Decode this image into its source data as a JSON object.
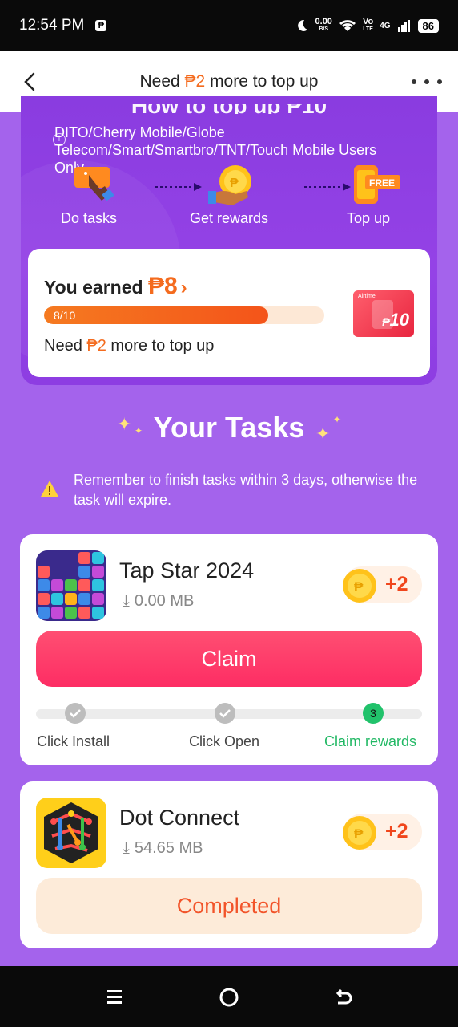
{
  "status_bar": {
    "time": "12:54 PM",
    "speed_value": "0.00",
    "speed_unit": "B/S",
    "volte_top": "Vo",
    "volte_bottom": "LTE",
    "network": "4G",
    "battery": "86"
  },
  "header": {
    "title_prefix": "Need ",
    "title_amount": "₱2",
    "title_suffix": " more to top up"
  },
  "panel": {
    "title": "How to top up ₱10",
    "notice": "DITO/Cherry Mobile/Globe Telecom/Smart/Smartbro/TNT/Touch Mobile Users Only",
    "steps": [
      "Do tasks",
      "Get rewards",
      "Top up"
    ],
    "free_badge": "FREE"
  },
  "earned": {
    "label": "You earned ",
    "amount": "₱8",
    "progress_text": "8/10",
    "progress_fraction": 0.8,
    "need_prefix": "Need ",
    "need_amount": "₱2",
    "need_suffix": " more to top up",
    "voucher_brand": "Airtime",
    "voucher_value": "10",
    "voucher_currency": "₱"
  },
  "tasks_section": {
    "title": "Your Tasks",
    "reminder": "Remember to finish tasks within 3 days, otherwise the task will expire."
  },
  "tasks": [
    {
      "name": "Tap Star 2024",
      "size": "0.00 MB",
      "reward": "+2",
      "button": "Claim",
      "steps": [
        "Click Install",
        "Click Open",
        "Claim rewards"
      ],
      "current_step_number": "3"
    },
    {
      "name": "Dot Connect",
      "size": "54.65 MB",
      "reward": "+2",
      "button": "Completed"
    }
  ],
  "colors": {
    "accent_orange": "#f46b1e",
    "purple_bg": "#a463ec",
    "claim_pink": "#fd2d64",
    "green": "#21c26b"
  }
}
